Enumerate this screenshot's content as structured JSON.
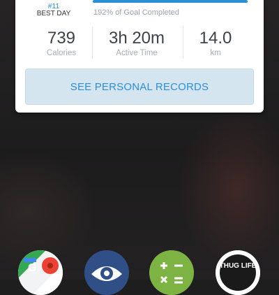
{
  "card": {
    "rank_partial": "...",
    "rank": "#11",
    "best_day_label": "BEST DAY",
    "progress_fraction": 1.0,
    "goal_text": "192% of Goal Completed",
    "stats": [
      {
        "value": "739",
        "label": "Calories"
      },
      {
        "value": "3h 20m",
        "label": "Active Time"
      },
      {
        "value": "14.0",
        "label": "km"
      }
    ],
    "records_button_label": "SEE PERSONAL RECORDS"
  },
  "dock": {
    "icons": [
      "google-maps-icon",
      "eye-app-icon",
      "calculator-icon",
      "thug-life-icon"
    ],
    "thug_life_text": "THUG LIFE"
  },
  "colors": {
    "accent": "#2b8fd6",
    "button_bg": "#d5e5ef"
  }
}
